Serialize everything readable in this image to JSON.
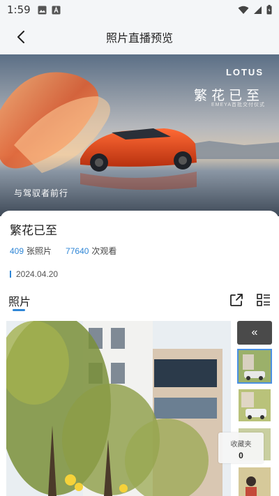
{
  "status_bar": {
    "time": "1:59",
    "icons": [
      "image-icon",
      "a-badge-icon",
      "wifi-icon",
      "signal-icon",
      "battery-icon"
    ]
  },
  "header": {
    "title": "照片直播预览"
  },
  "banner": {
    "brand": "LOTUS",
    "title": "繁花已至",
    "subtitle": "EMEYA首批交付仪式",
    "slogan": "与驾驭者前行"
  },
  "event": {
    "title": "繁花已至",
    "photo_count": "409",
    "photo_count_label": "张照片",
    "view_count": "77640",
    "view_count_label": "次观看",
    "date": "2024.04.20"
  },
  "tabs": {
    "photos_label": "照片"
  },
  "rail": {
    "collapse_symbol": "«",
    "favorites_label": "收藏夹",
    "favorites_count": "0"
  },
  "colors": {
    "accent": "#2f86d6",
    "status_bg": "#f4f6f8"
  }
}
